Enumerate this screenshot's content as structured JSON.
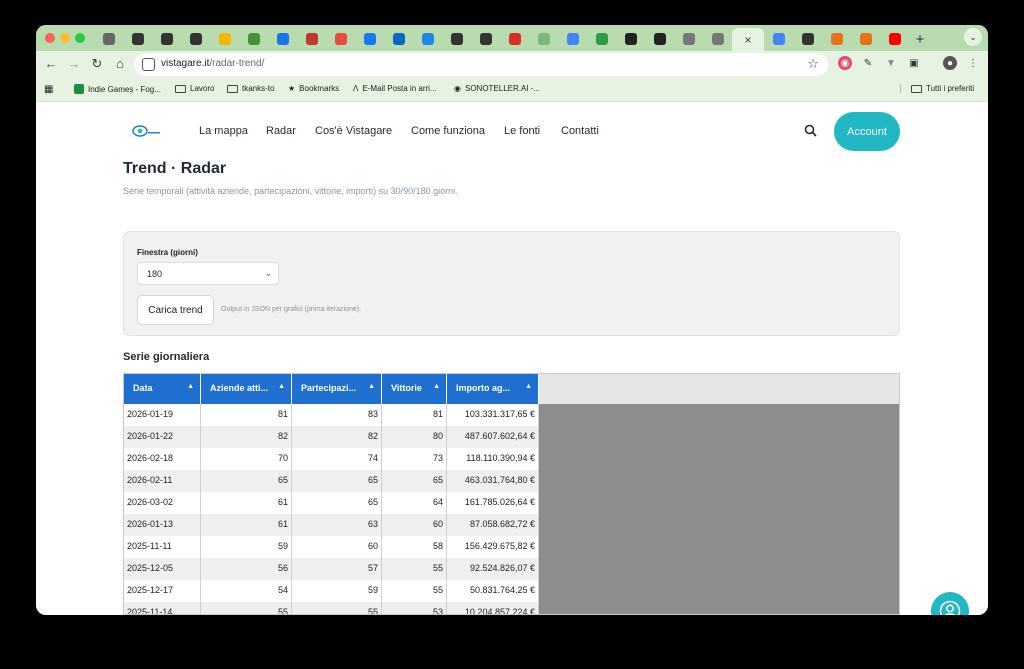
{
  "browser": {
    "tabs": [
      {
        "icon": "tab-icon-generic-1",
        "color": "#666666"
      },
      {
        "icon": "tab-icon-chess",
        "color": "#333333"
      },
      {
        "icon": "tab-icon-chess",
        "color": "#333333"
      },
      {
        "icon": "tab-icon-chess",
        "color": "#333333"
      },
      {
        "icon": "tab-icon-analytics",
        "color": "#f4b400"
      },
      {
        "icon": "tab-icon-globe",
        "color": "#4a8f3a"
      },
      {
        "icon": "tab-icon-drive",
        "color": "#1a73e8"
      },
      {
        "icon": "tab-icon-shield",
        "color": "#c0392b"
      },
      {
        "icon": "tab-icon-red",
        "color": "#e74c3c"
      },
      {
        "icon": "tab-icon-facebook",
        "color": "#1877f2"
      },
      {
        "icon": "tab-icon-linkedin",
        "color": "#0a66c2"
      },
      {
        "icon": "tab-icon-blue-circle",
        "color": "#1e88e5"
      },
      {
        "icon": "tab-icon-dark",
        "color": "#333333"
      },
      {
        "icon": "tab-icon-dark",
        "color": "#333333"
      },
      {
        "icon": "tab-icon-red-circle",
        "color": "#d93025"
      },
      {
        "icon": "tab-icon-green",
        "color": "#7fb77e"
      },
      {
        "icon": "tab-icon-doc",
        "color": "#4285f4"
      },
      {
        "icon": "tab-icon-green-dot",
        "color": "#2e9c49"
      },
      {
        "icon": "tab-icon-dark-square",
        "color": "#222222"
      },
      {
        "icon": "tab-icon-dark-square",
        "color": "#222222"
      },
      {
        "icon": "tab-icon-white",
        "color": "#777777"
      },
      {
        "icon": "tab-icon-white",
        "color": "#777777"
      },
      {
        "icon": "tab-icon-active",
        "color": "#e6f3e2",
        "active": true
      },
      {
        "icon": "tab-icon-c",
        "color": "#4285f4"
      },
      {
        "icon": "tab-icon-openai",
        "color": "#333333"
      },
      {
        "icon": "tab-icon-orange",
        "color": "#e8711a"
      },
      {
        "icon": "tab-icon-orange-2",
        "color": "#e8711a"
      },
      {
        "icon": "tab-icon-youtube",
        "color": "#ff0000"
      }
    ],
    "new_tab": "+",
    "url_host": "vistagare.it",
    "url_path": "/radar-trend/",
    "bookmarks": [
      {
        "label": "Indie Games - Fog...",
        "icon": "sheets-icon"
      },
      {
        "label": "Lavoro",
        "icon": "folder-icon"
      },
      {
        "label": "tkanks-to",
        "icon": "folder-icon"
      },
      {
        "label": "Bookmarks",
        "icon": "star-icon"
      },
      {
        "label": "E-Mail Posta in arri...",
        "icon": "mail-icon"
      },
      {
        "label": "SONOTELLER.AI -...",
        "icon": "sonoteller-icon"
      }
    ],
    "all_bookmarks": "Tutti i preferiti"
  },
  "site": {
    "nav": [
      "La mappa",
      "Radar",
      "Cos'è Vistagare",
      "Come funziona",
      "Le fonti",
      "Contatti"
    ],
    "account_label": "Account",
    "accent": "#22b8c3"
  },
  "page": {
    "title": "Trend · Radar",
    "subtitle": "Serie temporali (attività aziende, partecipazioni, vittorie, importi) su 30/90/180 giorni.",
    "window_label": "Finestra (giorni)",
    "window_value": "180",
    "load_button": "Carica trend",
    "hint": "Output in JSON per grafici (prima iterazione).",
    "section_title": "Serie giornaliera"
  },
  "table": {
    "header_color": "#1f6fd0",
    "columns": [
      "Data",
      "Aziende atti...",
      "Partecipazi...",
      "Vittorie",
      "Importo ag..."
    ],
    "rows": [
      [
        "2026-01-19",
        "81",
        "83",
        "81",
        "103.331.317,65 €"
      ],
      [
        "2026-01-22",
        "82",
        "82",
        "80",
        "487.607.602,64 €"
      ],
      [
        "2026-02-18",
        "70",
        "74",
        "73",
        "118.110.390,94 €"
      ],
      [
        "2026-02-11",
        "65",
        "65",
        "65",
        "463.031.764,80 €"
      ],
      [
        "2026-03-02",
        "61",
        "65",
        "64",
        "161.785.026,64 €"
      ],
      [
        "2026-01-13",
        "61",
        "63",
        "60",
        "87.058.682,72 €"
      ],
      [
        "2025-11-11",
        "59",
        "60",
        "58",
        "156.429.675,82 €"
      ],
      [
        "2025-12-05",
        "56",
        "57",
        "55",
        "92.524.826,07 €"
      ],
      [
        "2025-12-17",
        "54",
        "59",
        "55",
        "50.831.764,25 €"
      ],
      [
        "2025-11-14",
        "55",
        "55",
        "53",
        "10.204.857.224 €"
      ]
    ]
  }
}
